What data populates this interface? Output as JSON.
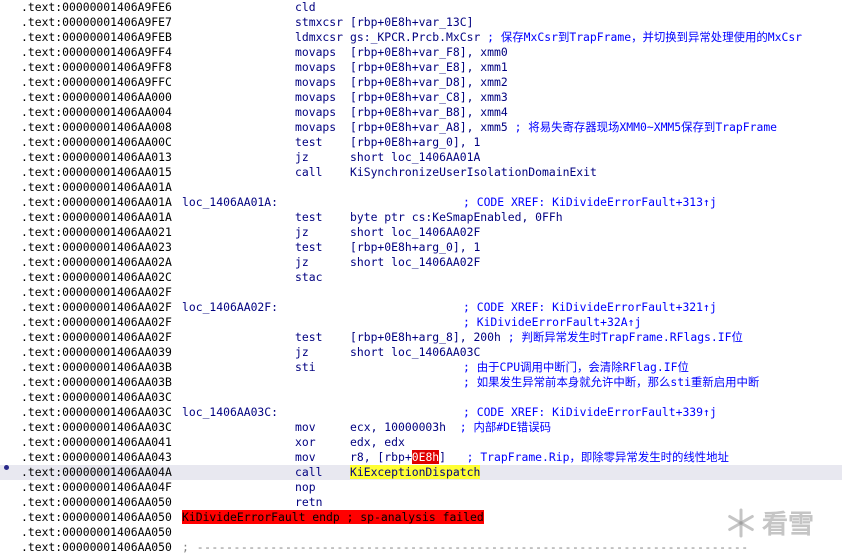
{
  "lines": [
    {
      "addr": ".text:00000001406A9FE6",
      "label": "",
      "mnem": "cld",
      "ops": [],
      "cmt": "",
      "dot": false
    },
    {
      "addr": ".text:00000001406A9FE7",
      "label": "",
      "mnem": "stmxcsr",
      "ops": [
        {
          "t": "[rbp+0E8h+var_13C]"
        }
      ],
      "cmt": "",
      "dot": false
    },
    {
      "addr": ".text:00000001406A9FEB",
      "label": "",
      "mnem": "ldmxcsr",
      "ops": [
        {
          "t": "gs:_KPCR.Prcb.MxCsr"
        },
        {
          "t": " ; 保存MxCsr到TrapFrame，并切换到异常处理使用的MxCsr",
          "c": "inl"
        }
      ],
      "cmt": "",
      "dot": false
    },
    {
      "addr": ".text:00000001406A9FF4",
      "label": "",
      "mnem": "movaps",
      "ops": [
        {
          "t": "[rbp+0E8h+var_F8], xmm0"
        }
      ],
      "cmt": "",
      "dot": false
    },
    {
      "addr": ".text:00000001406A9FF8",
      "label": "",
      "mnem": "movaps",
      "ops": [
        {
          "t": "[rbp+0E8h+var_E8], xmm1"
        }
      ],
      "cmt": "",
      "dot": false
    },
    {
      "addr": ".text:00000001406A9FFC",
      "label": "",
      "mnem": "movaps",
      "ops": [
        {
          "t": "[rbp+0E8h+var_D8], xmm2"
        }
      ],
      "cmt": "",
      "dot": false
    },
    {
      "addr": ".text:00000001406AA000",
      "label": "",
      "mnem": "movaps",
      "ops": [
        {
          "t": "[rbp+0E8h+var_C8], xmm3"
        }
      ],
      "cmt": "",
      "dot": false
    },
    {
      "addr": ".text:00000001406AA004",
      "label": "",
      "mnem": "movaps",
      "ops": [
        {
          "t": "[rbp+0E8h+var_B8], xmm4"
        }
      ],
      "cmt": "",
      "dot": false
    },
    {
      "addr": ".text:00000001406AA008",
      "label": "",
      "mnem": "movaps",
      "ops": [
        {
          "t": "[rbp+0E8h+var_A8], xmm5"
        },
        {
          "t": " ; 将易失寄存器现场XMM0~XMM5保存到TrapFrame",
          "c": "inl"
        }
      ],
      "cmt": "",
      "dot": false
    },
    {
      "addr": ".text:00000001406AA00C",
      "label": "",
      "mnem": "test",
      "ops": [
        {
          "t": "[rbp+0E8h+arg_0], 1"
        }
      ],
      "cmt": "",
      "dot": false
    },
    {
      "addr": ".text:00000001406AA013",
      "label": "",
      "mnem": "jz",
      "ops": [
        {
          "t": "short loc_1406AA01A"
        }
      ],
      "cmt": "",
      "dot": false
    },
    {
      "addr": ".text:00000001406AA015",
      "label": "",
      "mnem": "call",
      "ops": [
        {
          "t": "KiSynchronizeUserIsolationDomainExit"
        }
      ],
      "cmt": "",
      "dot": false
    },
    {
      "addr": ".text:00000001406AA01A",
      "label": "",
      "mnem": "",
      "ops": [],
      "cmt": "",
      "dot": false
    },
    {
      "addr": ".text:00000001406AA01A",
      "label": "loc_1406AA01A:",
      "mnem": "",
      "ops": [],
      "cmt": "; CODE XREF: KiDivideErrorFault+313↑j",
      "dot": false
    },
    {
      "addr": ".text:00000001406AA01A",
      "label": "",
      "mnem": "test",
      "ops": [
        {
          "t": "byte ptr cs:KeSmapEnabled, 0FFh"
        }
      ],
      "cmt": "",
      "dot": false
    },
    {
      "addr": ".text:00000001406AA021",
      "label": "",
      "mnem": "jz",
      "ops": [
        {
          "t": "short loc_1406AA02F"
        }
      ],
      "cmt": "",
      "dot": false
    },
    {
      "addr": ".text:00000001406AA023",
      "label": "",
      "mnem": "test",
      "ops": [
        {
          "t": "[rbp+0E8h+arg_0], 1"
        }
      ],
      "cmt": "",
      "dot": false
    },
    {
      "addr": ".text:00000001406AA02A",
      "label": "",
      "mnem": "jz",
      "ops": [
        {
          "t": "short loc_1406AA02F"
        }
      ],
      "cmt": "",
      "dot": false
    },
    {
      "addr": ".text:00000001406AA02C",
      "label": "",
      "mnem": "stac",
      "ops": [],
      "cmt": "",
      "dot": false
    },
    {
      "addr": ".text:00000001406AA02F",
      "label": "",
      "mnem": "",
      "ops": [],
      "cmt": "",
      "dot": false
    },
    {
      "addr": ".text:00000001406AA02F",
      "label": "loc_1406AA02F:",
      "mnem": "",
      "ops": [],
      "cmt": "; CODE XREF: KiDivideErrorFault+321↑j",
      "dot": false
    },
    {
      "addr": ".text:00000001406AA02F",
      "label": "",
      "mnem": "",
      "ops": [],
      "cmt": "; KiDivideErrorFault+32A↑j",
      "dot": false
    },
    {
      "addr": ".text:00000001406AA02F",
      "label": "",
      "mnem": "test",
      "ops": [
        {
          "t": "[rbp+0E8h+arg_8], 200h"
        },
        {
          "t": " ; 判断异常发生时TrapFrame.RFlags.IF位",
          "c": "inl"
        }
      ],
      "cmt": "",
      "dot": false
    },
    {
      "addr": ".text:00000001406AA039",
      "label": "",
      "mnem": "jz",
      "ops": [
        {
          "t": "short loc_1406AA03C"
        }
      ],
      "cmt": "",
      "dot": false
    },
    {
      "addr": ".text:00000001406AA03B",
      "label": "",
      "mnem": "sti",
      "ops": [],
      "cmt": "; 由于CPU调用中断门，会清除RFlag.IF位",
      "dot": false
    },
    {
      "addr": ".text:00000001406AA03B",
      "label": "",
      "mnem": "",
      "ops": [],
      "cmt": "; 如果发生异常前本身就允许中断，那么sti重新启用中断",
      "dot": false
    },
    {
      "addr": ".text:00000001406AA03C",
      "label": "",
      "mnem": "",
      "ops": [],
      "cmt": "",
      "dot": false
    },
    {
      "addr": ".text:00000001406AA03C",
      "label": "loc_1406AA03C:",
      "mnem": "",
      "ops": [],
      "cmt": "; CODE XREF: KiDivideErrorFault+339↑j",
      "dot": false
    },
    {
      "addr": ".text:00000001406AA03C",
      "label": "",
      "mnem": "mov",
      "ops": [
        {
          "t": "ecx, 10000003h"
        },
        {
          "t": "  ; 内部#DE错误码",
          "c": "inl"
        }
      ],
      "cmt": "",
      "dot": false
    },
    {
      "addr": ".text:00000001406AA041",
      "label": "",
      "mnem": "xor",
      "ops": [
        {
          "t": "edx, edx"
        }
      ],
      "cmt": "",
      "dot": false
    },
    {
      "addr": ".text:00000001406AA043",
      "label": "",
      "mnem": "mov",
      "ops": [
        {
          "t": "r8, [rbp+"
        },
        {
          "t": "0E8h",
          "c": "red"
        },
        {
          "t": "]"
        },
        {
          "t": "   ; TrapFrame.Rip，即除零异常发生时的线性地址",
          "c": "inl"
        }
      ],
      "cmt": "",
      "dot": false
    },
    {
      "addr": ".text:00000001406AA04A",
      "label": "",
      "mnem": "call",
      "ops": [
        {
          "t": "KiExceptionDispatch",
          "c": "yel"
        }
      ],
      "cmt": "",
      "dot": true,
      "hl": true
    },
    {
      "addr": ".text:00000001406AA04F",
      "label": "",
      "mnem": "nop",
      "ops": [],
      "cmt": "",
      "dot": false
    },
    {
      "addr": ".text:00000001406AA050",
      "label": "",
      "mnem": "retn",
      "ops": [],
      "cmt": "",
      "dot": false
    },
    {
      "addr": ".text:00000001406AA050",
      "label": "KiDivideErrorFault endp ; sp-analysis failed",
      "labelRed": true,
      "mnem": "",
      "ops": [],
      "cmt": "",
      "dot": false
    },
    {
      "addr": ".text:00000001406AA050",
      "label": "",
      "mnem": "",
      "ops": [],
      "cmt": "",
      "dot": false
    },
    {
      "addr": ".text:00000001406AA050",
      "label": "",
      "mnem": "",
      "ops": [],
      "cmt": "",
      "sep": "; ---------------------------------------------------------------------------",
      "dot": false
    }
  ],
  "watermark": {
    "text": "看雪",
    "icon": "snowflake-icon"
  }
}
